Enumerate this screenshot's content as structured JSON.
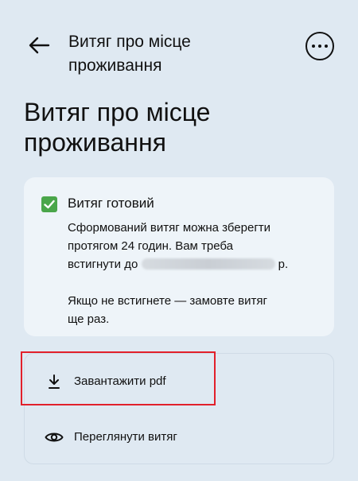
{
  "header": {
    "title": "Витяг про місце проживання",
    "back_icon": "arrow-left-icon",
    "more_icon": "more-horizontal-icon"
  },
  "page": {
    "title": "Витяг про місце проживання"
  },
  "status_card": {
    "icon": "check-square-icon",
    "title": "Витяг готовий",
    "line1": "Сформований витяг можна зберегти",
    "line2": "протягом 24 годин. Вам треба",
    "line3_prefix": "встигнути до",
    "line3_suffix": "р.",
    "line4": "Якщо не встигнете — замовте витяг",
    "line5": "ще раз."
  },
  "actions": {
    "download_label": "Завантажити pdf",
    "download_icon": "download-icon",
    "view_label": "Переглянути витяг",
    "view_icon": "eye-icon"
  },
  "colors": {
    "background": "#dfe9f2",
    "card": "#eef4f9",
    "accent_green": "#4aa64a",
    "highlight_red": "#e2202b"
  }
}
